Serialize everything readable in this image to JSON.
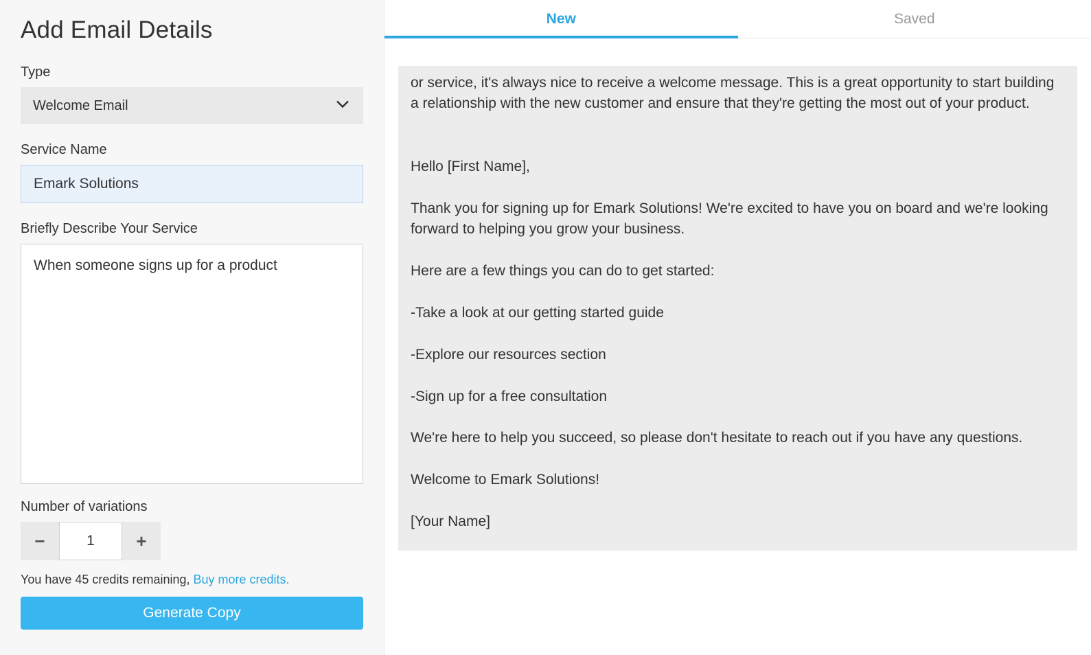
{
  "left": {
    "heading": "Add Email Details",
    "type_label": "Type",
    "type_value": "Welcome Email",
    "service_label": "Service Name",
    "service_value": "Emark Solutions",
    "describe_label": "Briefly Describe Your Service",
    "describe_value": "When someone signs up for a product",
    "variations_label": "Number of variations",
    "variations_value": "1",
    "credits_prefix": "You have 45 credits remaining, ",
    "buy_more_label": "Buy more credits.",
    "generate_label": "Generate Copy"
  },
  "tabs": {
    "new": "New",
    "saved": "Saved"
  },
  "output": {
    "text": "or service, it's always nice to receive a welcome message. This is a great opportunity to start building a relationship with the new customer and ensure that they're getting the most out of your product.\n\n\nHello [First Name],\n\nThank you for signing up for Emark Solutions! We're excited to have you on board and we're looking forward to helping you grow your business.\n\nHere are a few things you can do to get started:\n\n-Take a look at our getting started guide\n\n-Explore our resources section\n\n-Sign up for a free consultation\n\nWe're here to help you succeed, so please don't hesitate to reach out if you have any questions.\n\nWelcome to Emark Solutions!\n\n[Your Name]"
  }
}
